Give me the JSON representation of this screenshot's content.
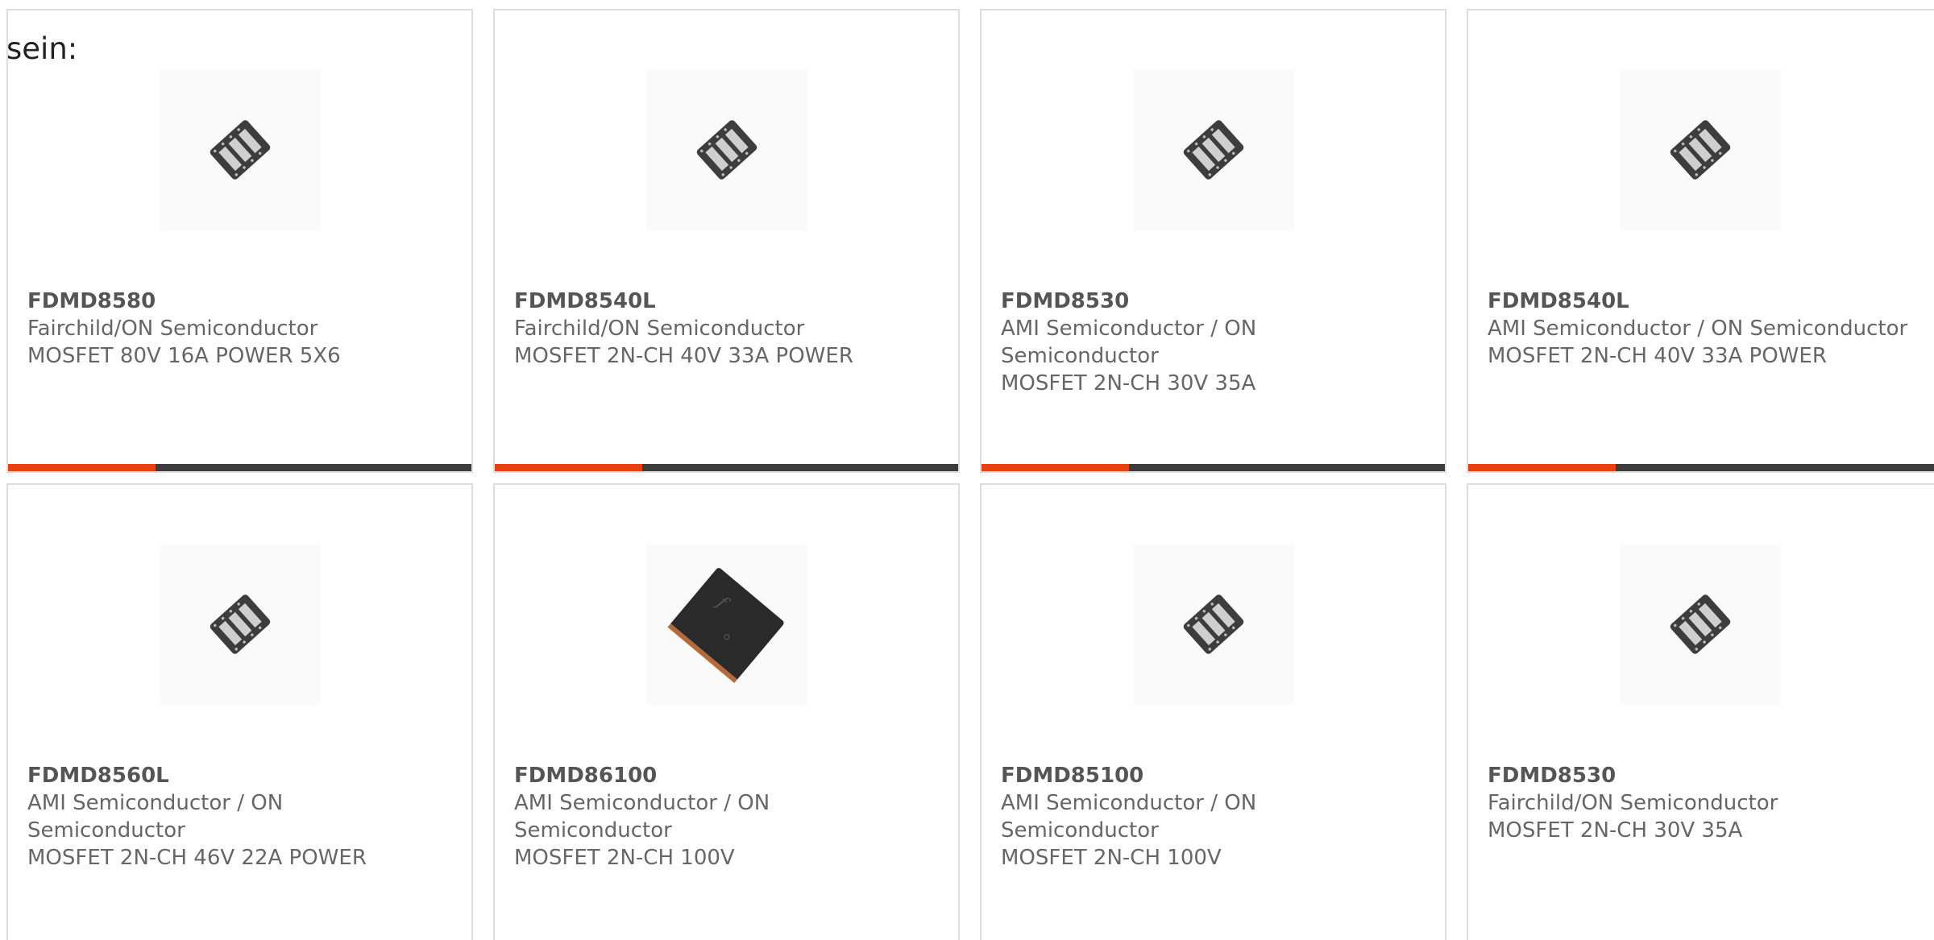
{
  "intro_text": "sein:",
  "colors": {
    "accent_bar": "#e8410f",
    "dark_bar": "#3c3c3c",
    "card_border": "#dddddd",
    "text": "#666666"
  },
  "products": [
    {
      "part": "FDMD8580",
      "manufacturer": "Fairchild/ON Semiconductor",
      "description": "MOSFET 80V 16A POWER 5X6",
      "image": "chip-dfn-icon"
    },
    {
      "part": "FDMD8540L",
      "manufacturer": "Fairchild/ON Semiconductor",
      "description": "MOSFET 2N-CH 40V 33A POWER",
      "image": "chip-dfn-icon"
    },
    {
      "part": "FDMD8530",
      "manufacturer": "AMI Semiconductor / ON Semiconductor",
      "description": "MOSFET 2N-CH 30V 35A",
      "image": "chip-dfn-icon"
    },
    {
      "part": "FDMD8540L",
      "manufacturer": "AMI Semiconductor / ON Semiconductor",
      "description": "MOSFET 2N-CH 40V 33A POWER",
      "image": "chip-dfn-icon"
    },
    {
      "part": "FDMD8560L",
      "manufacturer": "AMI Semiconductor / ON Semiconductor",
      "description": "MOSFET 2N-CH 46V 22A POWER",
      "image": "chip-dfn-icon"
    },
    {
      "part": "FDMD86100",
      "manufacturer": "AMI Semiconductor / ON Semiconductor",
      "description": "MOSFET 2N-CH 100V",
      "image": "chip-black-icon"
    },
    {
      "part": "FDMD85100",
      "manufacturer": "AMI Semiconductor / ON Semiconductor",
      "description": "MOSFET 2N-CH 100V",
      "image": "chip-dfn-icon"
    },
    {
      "part": "FDMD8530",
      "manufacturer": "Fairchild/ON Semiconductor",
      "description": "MOSFET 2N-CH 30V 35A",
      "image": "chip-dfn-icon"
    }
  ]
}
